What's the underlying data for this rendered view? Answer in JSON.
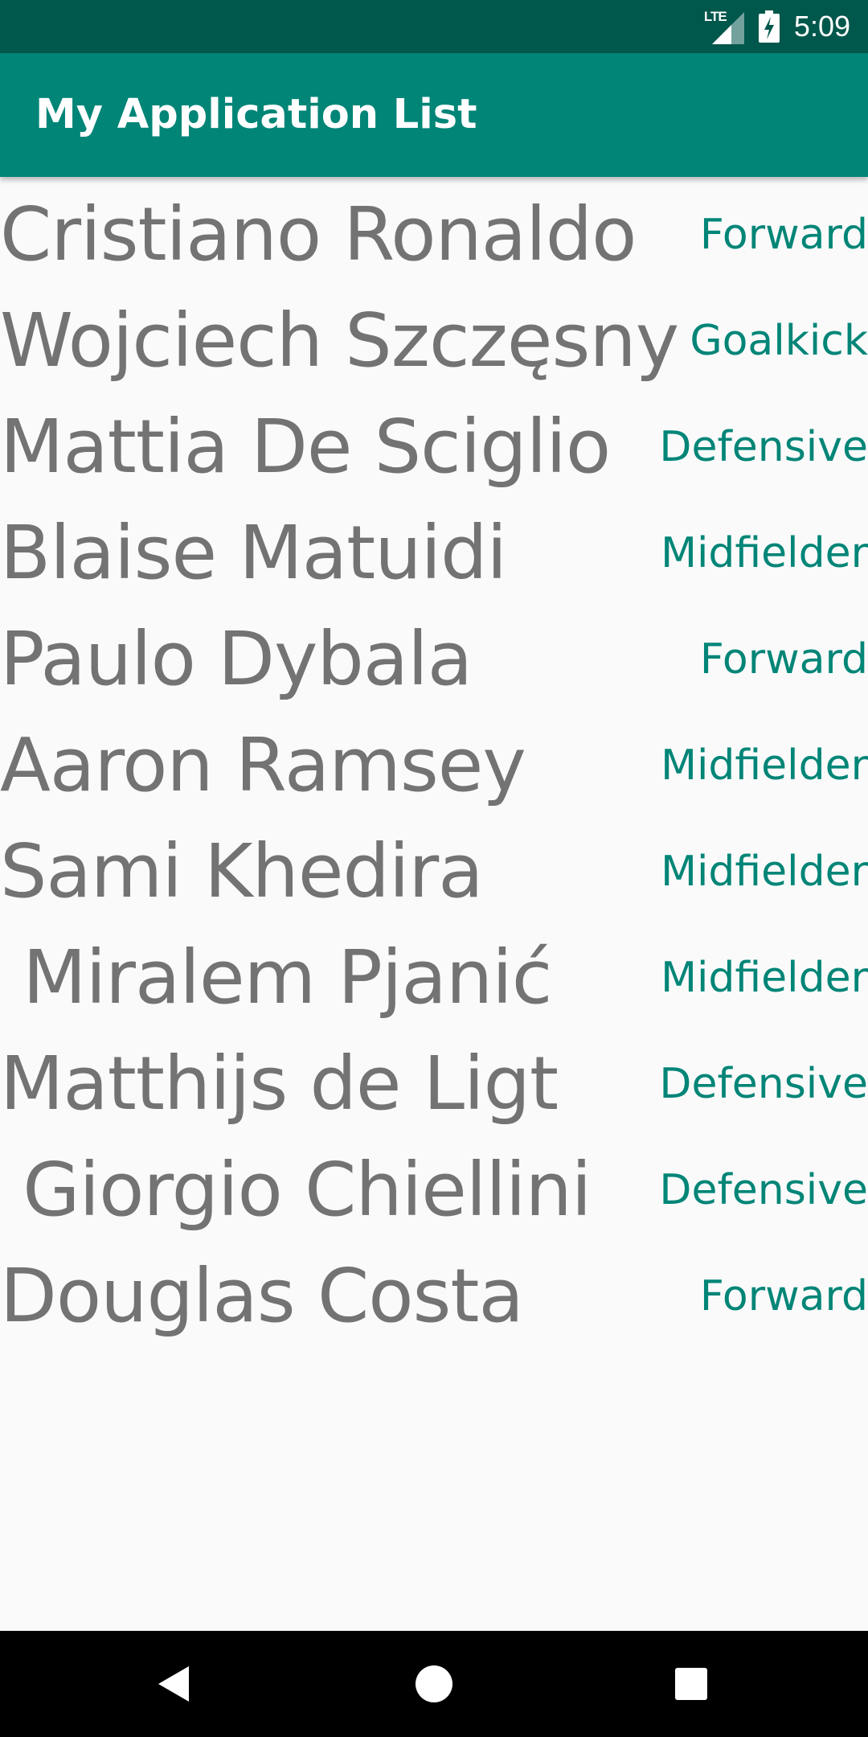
{
  "status_bar": {
    "network_label": "LTE",
    "time": "5:09"
  },
  "app_bar": {
    "title": "My Application List"
  },
  "players": [
    {
      "name": "Cristiano Ronaldo",
      "position": "Forward"
    },
    {
      "name": "Wojciech Szczęsny",
      "position": "Goalkick"
    },
    {
      "name": "Mattia De Sciglio",
      "position": "Defensive"
    },
    {
      "name": "Blaise Matuidi",
      "position": "Midfielder"
    },
    {
      "name": "Paulo Dybala",
      "position": "Forward"
    },
    {
      "name": "Aaron Ramsey",
      "position": "Midfielder"
    },
    {
      "name": "Sami Khedira",
      "position": "Midfielder"
    },
    {
      "name": " Miralem Pjanić",
      "position": "Midfielder"
    },
    {
      "name": "Matthijs de Ligt",
      "position": "Defensive"
    },
    {
      "name": " Giorgio Chiellini",
      "position": "Defensive"
    },
    {
      "name": "Douglas Costa",
      "position": "Forward"
    }
  ],
  "nav_bar": {
    "back_icon": "back-triangle-icon",
    "home_icon": "home-circle-icon",
    "recents_icon": "recents-square-icon"
  },
  "colors": {
    "status_bar": "#00574b",
    "app_bar": "#008577",
    "accent": "#008577",
    "name_text": "#737373",
    "background": "#fafafa"
  }
}
